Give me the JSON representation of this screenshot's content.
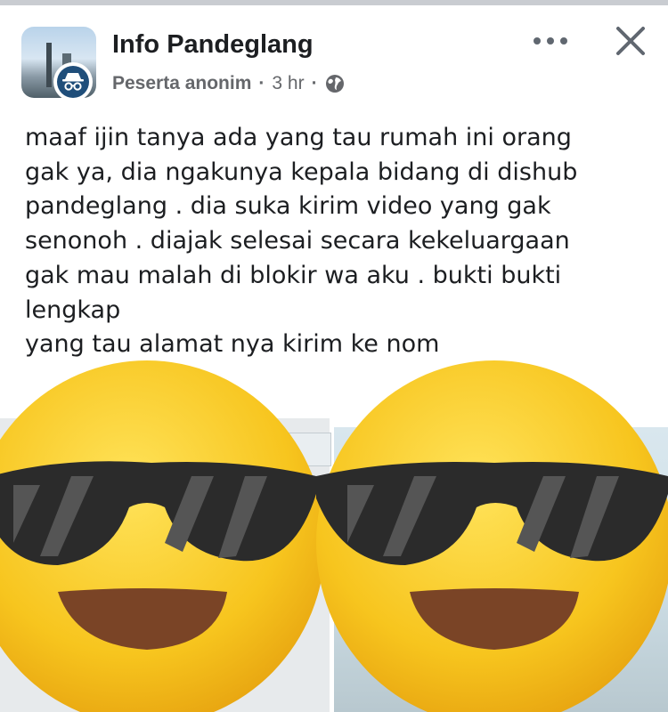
{
  "post": {
    "group_name": "Info Pandeglang",
    "author": "Peserta anonim",
    "separator": "·",
    "time": "3 hr",
    "privacy_icon": "globe-icon",
    "text_lines": [
      "maaf ijin tanya ada yang tau rumah ini orang",
      "gak ya, dia ngakunya kepala bidang di dishub",
      "pandeglang .  dia suka kirim video yang gak",
      "senonoh . diajak selesai secara kekeluargaan",
      "gak mau malah di blokir wa aku . bukti bukti",
      "lengkap",
      "yang tau alamat nya kirim ke nom"
    ]
  },
  "icons": {
    "more": "more-options-icon",
    "close": "close-icon",
    "anonymous": "anonymous-incognito-icon",
    "overlay": "sunglasses-face-emoji"
  },
  "colors": {
    "text_primary": "#1c1e21",
    "text_secondary": "#65676b",
    "emoji_yellow": "#f7c51e",
    "badge_blue": "#1f4e7a"
  }
}
